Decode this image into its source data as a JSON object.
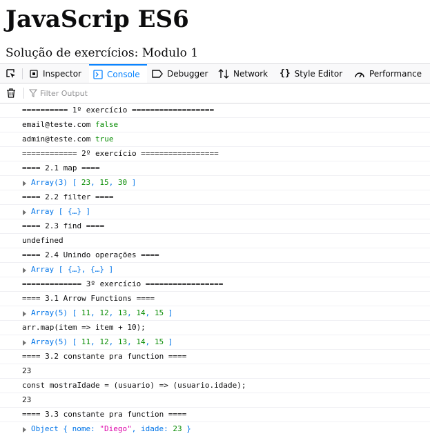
{
  "page": {
    "title": "JavaScrip ES6",
    "subtitle": "Solução de exercícios: Modulo 1"
  },
  "devtools": {
    "tabs": [
      {
        "label": "Inspector",
        "icon": "inspector-icon"
      },
      {
        "label": "Console",
        "icon": "console-icon",
        "selected": true
      },
      {
        "label": "Debugger",
        "icon": "debugger-icon"
      },
      {
        "label": "Network",
        "icon": "network-icon"
      },
      {
        "label": "Style Editor",
        "icon": "style-editor-icon"
      },
      {
        "label": "Performance",
        "icon": "performance-icon"
      }
    ],
    "filter_placeholder": "Filter Output",
    "colors": {
      "accent": "#0a84ff",
      "number": "#058b00",
      "object": "#0074e8",
      "string": "#dd00a9",
      "muted": "#737373"
    }
  },
  "console": {
    "lines": [
      {
        "text": "========== 1º exercício =================="
      },
      {
        "text": "email@teste.com",
        "value": "false"
      },
      {
        "text": "admin@teste.com",
        "value": "true"
      },
      {
        "text": "============ 2º exercício ================="
      },
      {
        "text": "==== 2.1 map ===="
      },
      {
        "obj": "Array(3)",
        "open": "[ ",
        "n1": "23",
        "s1": ", ",
        "n2": "15",
        "s2": ", ",
        "n3": "30",
        "close": " ]"
      },
      {
        "text": "==== 2.2 filter ===="
      },
      {
        "obj": "Array",
        "open": "[ {…} ]"
      },
      {
        "text": "==== 2.3 find ===="
      },
      {
        "text": "undefined"
      },
      {
        "text": "==== 2.4 Unindo operações ===="
      },
      {
        "obj": "Array",
        "open": "[ {…}, {…} ]"
      },
      {
        "text": "============= 3º exercício ================="
      },
      {
        "text": "==== 3.1 Arrow Functions ===="
      },
      {
        "obj": "Array(5)",
        "open": "[ ",
        "n1": "11",
        "s1": ", ",
        "n2": "12",
        "s2": ", ",
        "n3": "13",
        "s3": ", ",
        "n4": "14",
        "s4": ", ",
        "n5": "15",
        "close": " ]"
      },
      {
        "text": "arr.map(item => item + 10);"
      },
      {
        "obj": "Array(5)",
        "open": "[ ",
        "n1": "11",
        "s1": ", ",
        "n2": "12",
        "s2": ", ",
        "n3": "13",
        "s3": ", ",
        "n4": "14",
        "s4": ", ",
        "n5": "15",
        "close": " ]"
      },
      {
        "text": "==== 3.2 constante pra function ===="
      },
      {
        "value": "23"
      },
      {
        "text": "const mostraIdade = (usuario) => (usuario.idade);"
      },
      {
        "value": "23"
      },
      {
        "text": "==== 3.3 constante pra function ===="
      },
      {
        "obj": "Object",
        "open": "{ nome: ",
        "str": "\"Diego\"",
        "mid": ", idade: ",
        "num": "23",
        "close": " }"
      }
    ]
  }
}
